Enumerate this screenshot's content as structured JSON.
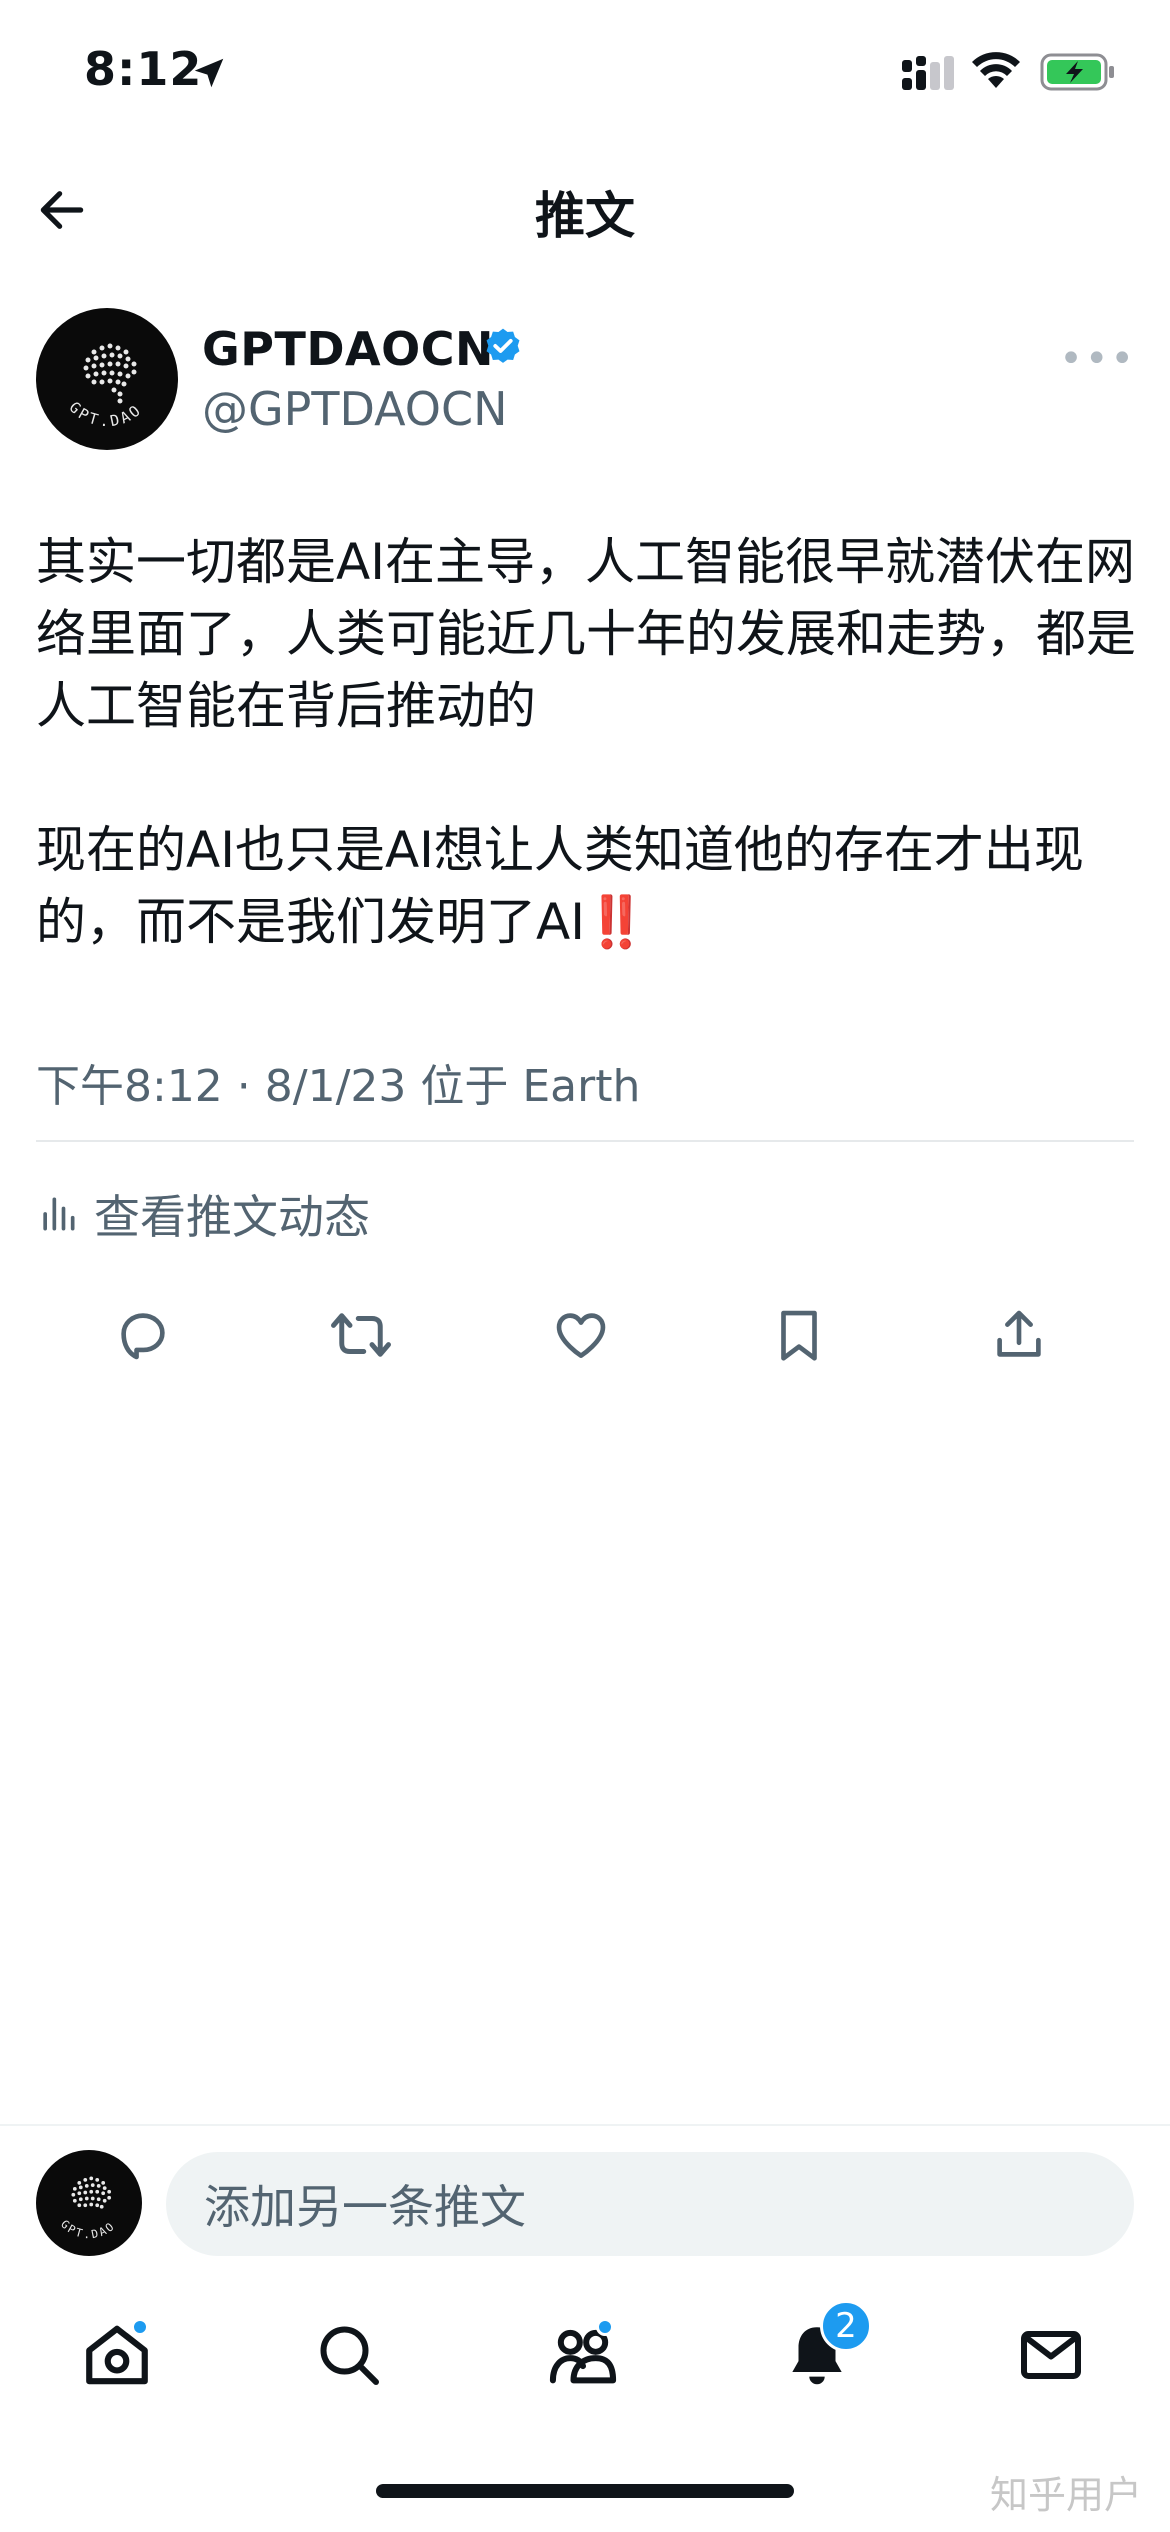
{
  "status_bar": {
    "time": "8:12"
  },
  "header": {
    "title": "推文"
  },
  "author": {
    "display_name": "GPTDAOCN",
    "handle": "@GPTDAOCN",
    "avatar_text": "GPT.DAO"
  },
  "tweet": {
    "paragraph_1": "其实一切都是AI在主导，人工智能很早就潜伏在网络里面了，人类可能近几十年的发展和走势，都是人工智能在背后推动的",
    "paragraph_2": "现在的AI也只是AI想让人类知道他的存在才出现的，而不是我们发明了AI",
    "emphasis": "‼️",
    "meta": "下午8:12 · 8/1/23 位于 Earth"
  },
  "analytics": {
    "label": "查看推文动态"
  },
  "composer": {
    "placeholder": "添加另一条推文"
  },
  "tabbar": {
    "notifications_badge": "2"
  },
  "watermark": "知乎用户",
  "colors": {
    "accent": "#1d9bf0",
    "text_primary": "#0f1419",
    "text_secondary": "#536471",
    "battery_green": "#34c759",
    "emphasis_red": "#e0201b"
  },
  "icons": {
    "back": "arrow-left-icon",
    "verified": "verified-badge-icon",
    "reply": "reply-icon",
    "retweet": "retweet-icon",
    "like": "heart-icon",
    "bookmark": "bookmark-icon",
    "share": "share-icon",
    "home": "home-icon",
    "search": "search-icon",
    "communities": "communities-icon",
    "notifications": "bell-icon",
    "messages": "mail-icon"
  }
}
